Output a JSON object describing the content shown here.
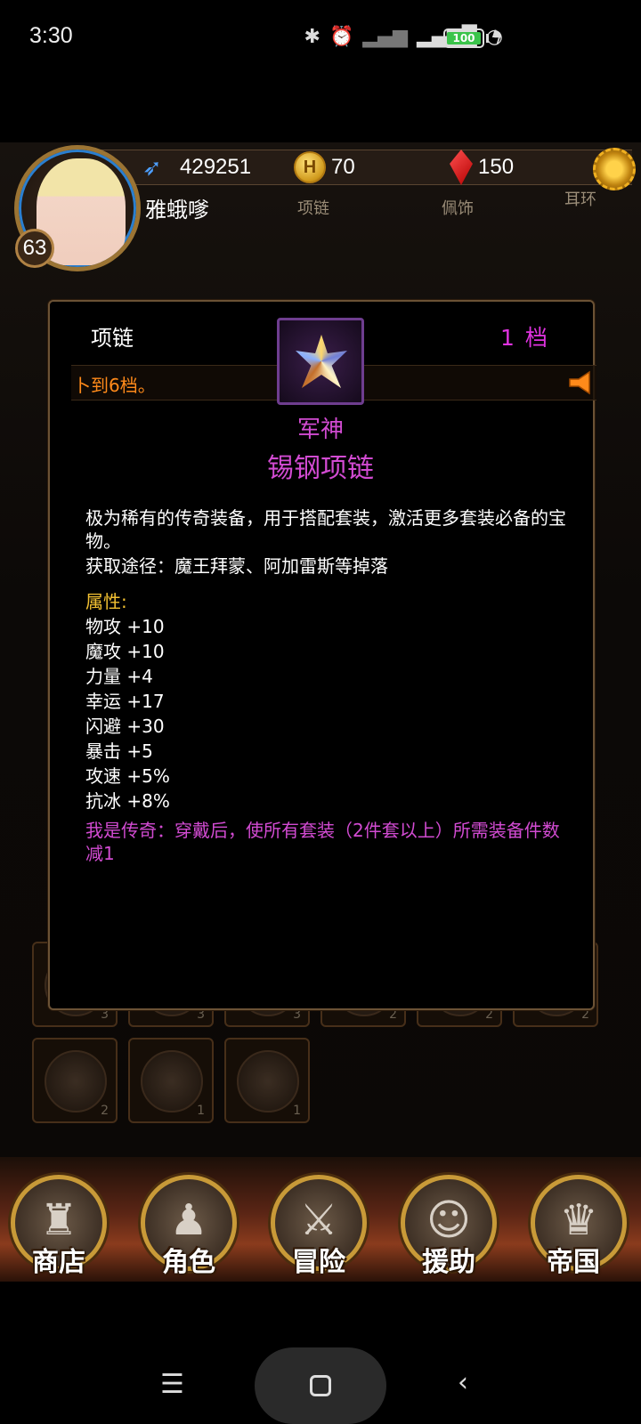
{
  "status_bar": {
    "time": "3:30",
    "battery": "100",
    "icons": [
      "bluetooth-icon",
      "alarm-icon",
      "signal-icon",
      "hd-signal-icon",
      "wifi-icon",
      "battery-icon",
      "charging-icon"
    ]
  },
  "player": {
    "power": "429251",
    "gold": "70",
    "gems": "150",
    "name": "雅蛾嗲",
    "level": "63"
  },
  "equip_slots": {
    "necklace_label": "项链",
    "pendant_label": "佩饰",
    "earring_label": "耳环"
  },
  "dialog": {
    "slot_type": "项链",
    "tier": "1 档",
    "ticker": "卜到6档。",
    "item_prefix": "军神",
    "item_name": "锡钢项链",
    "description": "极为稀有的传奇装备，用于搭配套装，激活更多套装必备的宝物。",
    "source": "获取途径：魔王拜蒙、阿加雷斯等掉落",
    "attributes_title": "属性:",
    "attributes": [
      "物攻 +10",
      "魔攻 +10",
      "力量 +4",
      "幸运 +17",
      "闪避 +30",
      "暴击 +5",
      "攻速 +5%",
      "抗冰 +8%"
    ],
    "special": "我是传奇：穿戴后，使所有套装（2件套以上）所需装备件数减1"
  },
  "bg_counts": [
    "3",
    "3",
    "3",
    "2",
    "2",
    "2",
    "2",
    "1",
    "1"
  ],
  "nav": {
    "shop": "商店",
    "character": "角色",
    "adventure": "冒险",
    "support": "援助",
    "empire": "帝国"
  },
  "colors": {
    "legendary": "#d24bd2",
    "attr_title": "#f2c032",
    "ticker": "#ff8a1a",
    "frame_gold": "#c89a38"
  }
}
